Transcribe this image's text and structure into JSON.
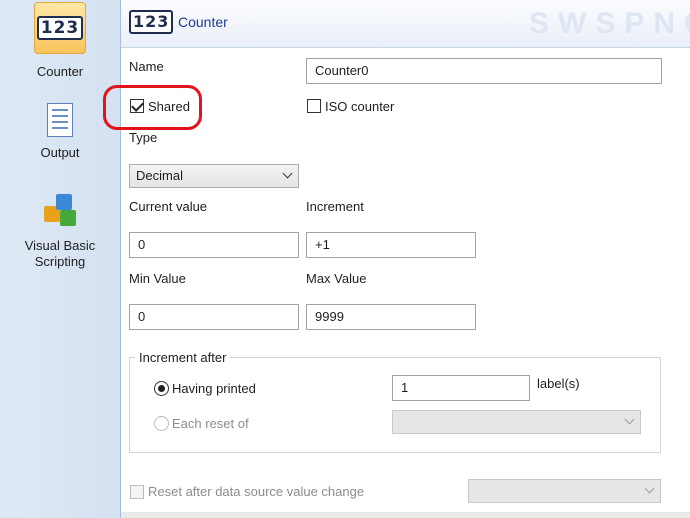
{
  "sidebar": {
    "items": [
      {
        "label": "Counter",
        "icon": "counter-123-icon",
        "glyph": "123",
        "selected": true
      },
      {
        "label": "Output",
        "icon": "output-document-icon"
      },
      {
        "label": "Visual Basic Scripting",
        "icon": "visual-basic-scripting-icon"
      }
    ]
  },
  "header": {
    "glyph": "123",
    "title": "Counter"
  },
  "form": {
    "name_label": "Name",
    "name_value": "Counter0",
    "shared_label": "Shared",
    "shared_checked": true,
    "iso_label": "ISO counter",
    "iso_checked": false,
    "type_label": "Type",
    "type_value": "Decimal",
    "current_value_label": "Current value",
    "current_value": "0",
    "increment_label": "Increment",
    "increment_value": "+1",
    "min_value_label": "Min Value",
    "min_value": "0",
    "max_value_label": "Max Value",
    "max_value": "9999"
  },
  "increment_after": {
    "title": "Increment after",
    "having_printed_label": "Having printed",
    "having_printed_selected": true,
    "labels_value": "1",
    "labels_suffix": "label(s)",
    "each_reset_label": "Each reset of",
    "each_reset_value": ""
  },
  "reset": {
    "label": "Reset after data source value change",
    "checked": false,
    "select_value": ""
  },
  "colors": {
    "highlight": "#e3131b",
    "header_title": "#1f3d8c"
  }
}
